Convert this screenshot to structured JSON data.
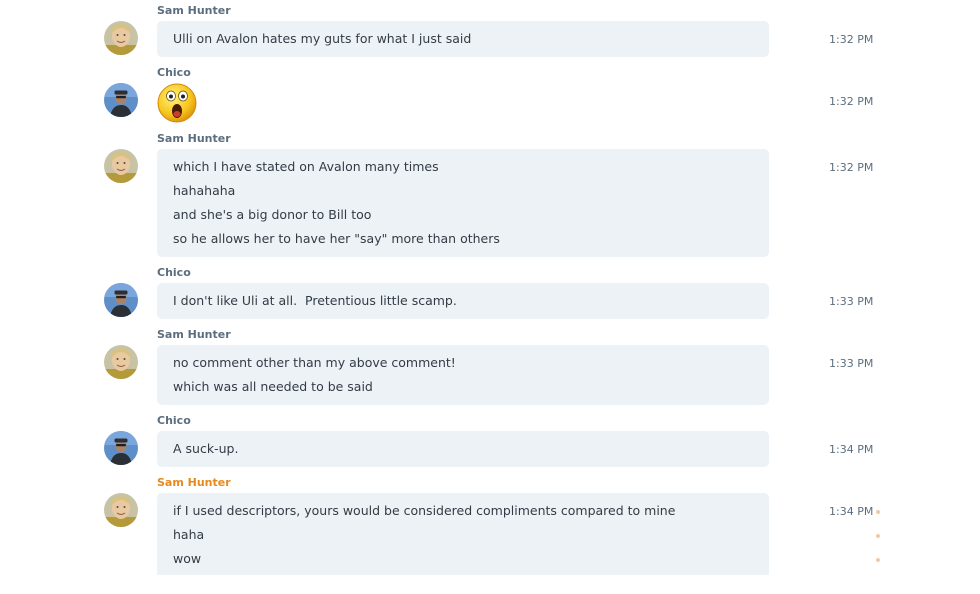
{
  "messages": [
    {
      "sender": "Sam Hunter",
      "avatar": "sam-hunter-avatar",
      "time": "1:32 PM",
      "lines": [
        "Ulli on Avalon hates my guts for what I just said"
      ]
    },
    {
      "sender": "Chico",
      "avatar": "chico-avatar",
      "time": "1:32 PM",
      "emoji": "surprised-face-emoticon"
    },
    {
      "sender": "Sam Hunter",
      "avatar": "sam-hunter-avatar",
      "time": "1:32 PM",
      "lines": [
        "which I have stated on Avalon many times",
        "hahahaha",
        "and she's a big donor to Bill too",
        "so he allows her to have her \"say\" more than others"
      ]
    },
    {
      "sender": "Chico",
      "avatar": "chico-avatar",
      "time": "1:33 PM",
      "lines": [
        "I don't like Uli at all.  Pretentious little scamp."
      ]
    },
    {
      "sender": "Sam Hunter",
      "avatar": "sam-hunter-avatar",
      "time": "1:33 PM",
      "lines": [
        "no comment other than my above comment!",
        "which was all needed to be said"
      ]
    },
    {
      "sender": "Chico",
      "avatar": "chico-avatar",
      "time": "1:34 PM",
      "lines": [
        "A suck-up."
      ]
    },
    {
      "sender": "Sam Hunter",
      "avatar": "sam-hunter-avatar",
      "time": "1:34 PM",
      "highlighted": true,
      "lines": [
        "if I used descriptors, yours would be considered compliments compared to mine",
        "haha",
        "wow"
      ]
    }
  ],
  "colors": {
    "bubble": "#edf2f7",
    "sender": "#5b6e80",
    "sender_active": "#e8891c",
    "text": "#333b44"
  }
}
